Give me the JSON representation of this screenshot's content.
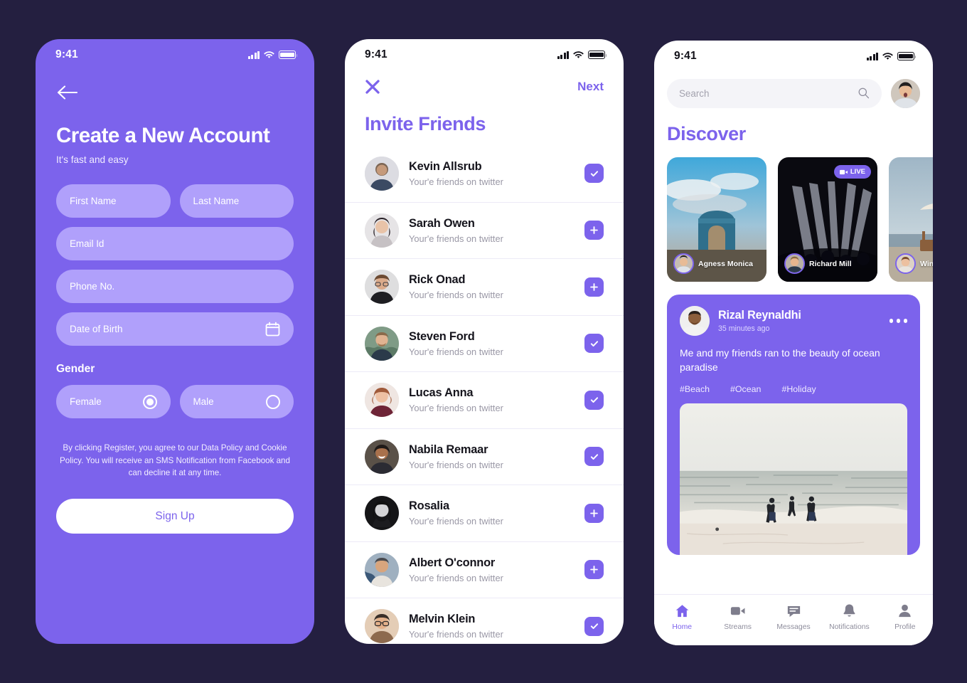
{
  "theme": {
    "page_bg": "#241f40",
    "purple": "#7c63ec",
    "field_purple": "#b0a0fb",
    "white": "#ffffff",
    "muted_text": "#9a98a6"
  },
  "screen1": {
    "statusbar": {
      "time": "9:41",
      "signal_icon": "cellular-bars-icon",
      "wifi_icon": "wifi-icon",
      "battery_icon": "battery-icon"
    },
    "back_icon": "back-arrow-icon",
    "title": "Create a New Account",
    "subtitle": "It's fast and easy",
    "fields": [
      {
        "name": "first-name",
        "placeholder": "First Name",
        "value": ""
      },
      {
        "name": "last-name",
        "placeholder": "Last Name",
        "value": ""
      },
      {
        "name": "email-id",
        "placeholder": "Email Id",
        "value": ""
      },
      {
        "name": "phone-no",
        "placeholder": "Phone No.",
        "value": ""
      },
      {
        "name": "date-of-birth",
        "placeholder": "Date of Birth",
        "value": "",
        "icon": "calendar-icon"
      }
    ],
    "gender_label": "Gender",
    "gender_options": [
      {
        "label": "Female",
        "selected": true
      },
      {
        "label": "Male",
        "selected": false
      }
    ],
    "legal_text": "By clicking Register, you agree to our Data Policy and Cookie Policy. You will receive an SMS Notification from Facebook and can decline it at any time.",
    "signup_label": "Sign Up"
  },
  "screen2": {
    "statusbar": {
      "time": "9:41"
    },
    "close_icon": "close-x-icon",
    "next_label": "Next",
    "title": "Invite Friends",
    "friends": [
      {
        "name": "Kevin Allsrub",
        "subtitle": "Your'e friends on twitter",
        "state": "added",
        "action_icon": "check-icon"
      },
      {
        "name": "Sarah Owen",
        "subtitle": "Your'e friends on twitter",
        "state": "invite",
        "action_icon": "plus-icon"
      },
      {
        "name": "Rick Onad",
        "subtitle": "Your'e friends on twitter",
        "state": "invite",
        "action_icon": "plus-icon"
      },
      {
        "name": "Steven Ford",
        "subtitle": "Your'e friends on twitter",
        "state": "added",
        "action_icon": "check-icon"
      },
      {
        "name": "Lucas Anna",
        "subtitle": "Your'e friends on twitter",
        "state": "added",
        "action_icon": "check-icon"
      },
      {
        "name": "Nabila Remaar",
        "subtitle": "Your'e friends on twitter",
        "state": "added",
        "action_icon": "check-icon"
      },
      {
        "name": "Rosalia",
        "subtitle": "Your'e friends on twitter",
        "state": "invite",
        "action_icon": "plus-icon"
      },
      {
        "name": "Albert O'connor",
        "subtitle": "Your'e friends on twitter",
        "state": "invite",
        "action_icon": "plus-icon"
      },
      {
        "name": "Melvin Klein",
        "subtitle": "Your'e friends on twitter",
        "state": "added",
        "action_icon": "check-icon"
      }
    ]
  },
  "screen3": {
    "statusbar": {
      "time": "9:41"
    },
    "search": {
      "placeholder": "Search",
      "value": "",
      "icon": "search-icon"
    },
    "profile_avatar": "user-avatar",
    "title": "Discover",
    "stories": [
      {
        "name": "Agness Monica",
        "live": false,
        "scene": "arc-de-triomphe"
      },
      {
        "name": "Richard Mill",
        "live": true,
        "live_label": "LIVE",
        "scene": "concert-stage"
      },
      {
        "name": "Win",
        "live": false,
        "scene": "beach-umbrella"
      }
    ],
    "post": {
      "author": "Rizal Reynaldhi",
      "time": "35 minutes ago",
      "menu_icon": "more-dots-icon",
      "text": "Me and my friends ran to the beauty of ocean paradise",
      "tags": [
        "#Beach",
        "#Ocean",
        "#Holiday"
      ],
      "photo_alt": "friends-running-into-ocean"
    },
    "tabs": [
      {
        "label": "Home",
        "icon": "home-icon",
        "active": true
      },
      {
        "label": "Streams",
        "icon": "video-camera-icon",
        "active": false
      },
      {
        "label": "Messages",
        "icon": "chat-bubble-icon",
        "active": false
      },
      {
        "label": "Notifications",
        "icon": "bell-icon",
        "active": false
      },
      {
        "label": "Profile",
        "icon": "person-icon",
        "active": false
      }
    ]
  }
}
